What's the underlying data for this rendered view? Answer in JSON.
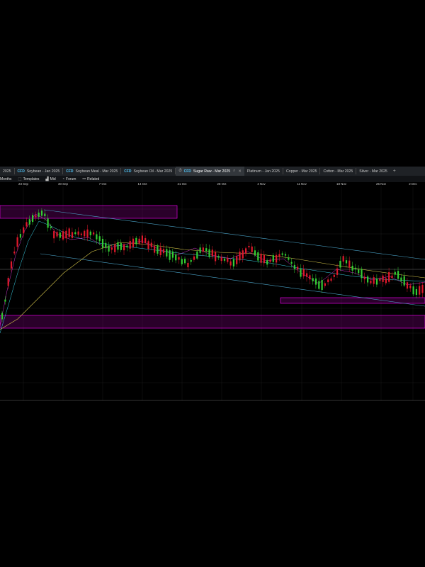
{
  "tabs": [
    {
      "cfd": "",
      "label": "2025",
      "active": false
    },
    {
      "cfd": "CFD",
      "label": "Soybean - Jan 2025",
      "active": false
    },
    {
      "cfd": "CFD",
      "label": "Soybean Meal - Mar 2025",
      "active": false
    },
    {
      "cfd": "CFD",
      "label": "Soybean Oil - Mar 2025",
      "active": false
    },
    {
      "cfd": "CFD",
      "label": "Sugar Raw - Mar 2025",
      "active": true
    },
    {
      "cfd": "",
      "label": "Platinum - Jan 2025",
      "active": false
    },
    {
      "cfd": "",
      "label": "Copper - Mar 2025",
      "active": false
    },
    {
      "cfd": "",
      "label": "Cotton - Mar 2025",
      "active": false
    },
    {
      "cfd": "",
      "label": "Silver - Mar 2025",
      "active": false
    }
  ],
  "toolbar": {
    "timeframe": "Months",
    "templates": "Templates",
    "mid": "Mid",
    "forum": "Forum",
    "related": "Related"
  },
  "dates": [
    "23 Sep",
    "30 Sep",
    "7 Oct",
    "14 Oct",
    "21 Oct",
    "28 Oct",
    "4 Nov",
    "11 Nov",
    "18 Nov",
    "25 Nov",
    "2 Dec"
  ],
  "colors": {
    "up": "#33cc33",
    "down": "#e0192c",
    "channel": "#4aa3c8",
    "zone": "#ff00ff",
    "ma_fast": "#cc33cc",
    "ma_mid": "#3ad0e6",
    "ma_slow": "#d8c84a"
  }
}
